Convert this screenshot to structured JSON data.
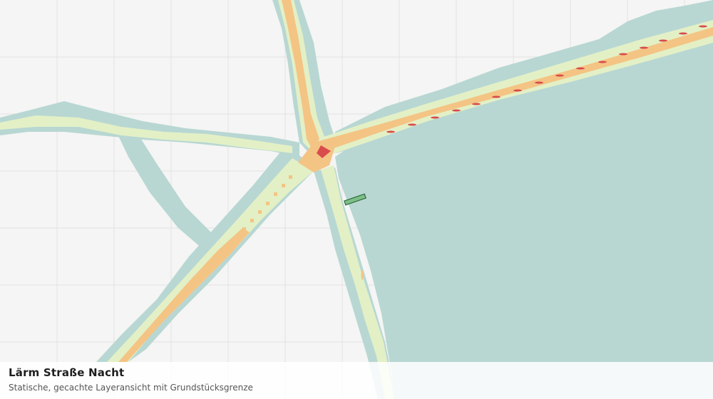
{
  "map": {
    "layer_title": "Lärm Straße Nacht",
    "layer_subtitle": "Statische, gecachte Layeransicht mit Grundstücksgrenze",
    "grid_visible": true,
    "colors": {
      "background": "#f4f5f4",
      "grid": "#e2e4e2",
      "noise_band_outer": "#b8d7d3",
      "noise_band_mid": "#e3f0c6",
      "noise_band_high": "#f4c484",
      "noise_band_peak": "#d94c4c",
      "parcel_fill": "#7cbf88",
      "parcel_outline": "#2f6a3c"
    }
  }
}
